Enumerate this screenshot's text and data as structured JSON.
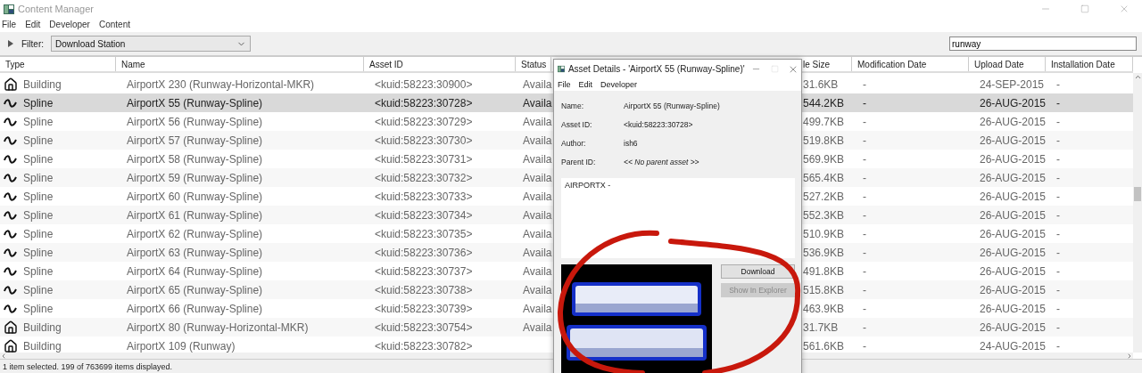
{
  "window": {
    "title": "Content Manager"
  },
  "menu": [
    "File",
    "Edit",
    "Developer",
    "Content"
  ],
  "filter": {
    "label": "Filter:",
    "value": "Download Station"
  },
  "search": {
    "value": "runway"
  },
  "table": {
    "columns": [
      "Type",
      "Name",
      "Asset ID",
      "Status",
      "le Size",
      "Modification Date",
      "Upload Date",
      "Installation Date"
    ],
    "rows": [
      {
        "kind": "building",
        "type": "Building",
        "name": "AirportX 230 (Runway-Horizontal-MKR)",
        "asset_id": "<kuid:58223:30900>",
        "status": "Availa",
        "file_size": "31.6KB",
        "modification_date": "-",
        "upload_date": "24-SEP-2015",
        "installation_date": "-",
        "selected": false
      },
      {
        "kind": "spline",
        "type": "Spline",
        "name": "AirportX 55 (Runway-Spline)",
        "asset_id": "<kuid:58223:30728>",
        "status": "Availa",
        "file_size": "544.2KB",
        "modification_date": "-",
        "upload_date": "26-AUG-2015",
        "installation_date": "-",
        "selected": true
      },
      {
        "kind": "spline",
        "type": "Spline",
        "name": "AirportX 56 (Runway-Spline)",
        "asset_id": "<kuid:58223:30729>",
        "status": "Availa",
        "file_size": "499.7KB",
        "modification_date": "-",
        "upload_date": "26-AUG-2015",
        "installation_date": "-",
        "selected": false
      },
      {
        "kind": "spline",
        "type": "Spline",
        "name": "AirportX 57 (Runway-Spline)",
        "asset_id": "<kuid:58223:30730>",
        "status": "Availa",
        "file_size": "519.8KB",
        "modification_date": "-",
        "upload_date": "26-AUG-2015",
        "installation_date": "-",
        "selected": false
      },
      {
        "kind": "spline",
        "type": "Spline",
        "name": "AirportX 58 (Runway-Spline)",
        "asset_id": "<kuid:58223:30731>",
        "status": "Availa",
        "file_size": "569.9KB",
        "modification_date": "-",
        "upload_date": "26-AUG-2015",
        "installation_date": "-",
        "selected": false
      },
      {
        "kind": "spline",
        "type": "Spline",
        "name": "AirportX 59 (Runway-Spline)",
        "asset_id": "<kuid:58223:30732>",
        "status": "Availa",
        "file_size": "565.4KB",
        "modification_date": "-",
        "upload_date": "26-AUG-2015",
        "installation_date": "-",
        "selected": false
      },
      {
        "kind": "spline",
        "type": "Spline",
        "name": "AirportX 60 (Runway-Spline)",
        "asset_id": "<kuid:58223:30733>",
        "status": "Availa",
        "file_size": "527.2KB",
        "modification_date": "-",
        "upload_date": "26-AUG-2015",
        "installation_date": "-",
        "selected": false
      },
      {
        "kind": "spline",
        "type": "Spline",
        "name": "AirportX 61 (Runway-Spline)",
        "asset_id": "<kuid:58223:30734>",
        "status": "Availa",
        "file_size": "552.3KB",
        "modification_date": "-",
        "upload_date": "26-AUG-2015",
        "installation_date": "-",
        "selected": false
      },
      {
        "kind": "spline",
        "type": "Spline",
        "name": "AirportX 62 (Runway-Spline)",
        "asset_id": "<kuid:58223:30735>",
        "status": "Availa",
        "file_size": "510.9KB",
        "modification_date": "-",
        "upload_date": "26-AUG-2015",
        "installation_date": "-",
        "selected": false
      },
      {
        "kind": "spline",
        "type": "Spline",
        "name": "AirportX 63 (Runway-Spline)",
        "asset_id": "<kuid:58223:30736>",
        "status": "Availa",
        "file_size": "536.9KB",
        "modification_date": "-",
        "upload_date": "26-AUG-2015",
        "installation_date": "-",
        "selected": false
      },
      {
        "kind": "spline",
        "type": "Spline",
        "name": "AirportX 64 (Runway-Spline)",
        "asset_id": "<kuid:58223:30737>",
        "status": "Availa",
        "file_size": "491.8KB",
        "modification_date": "-",
        "upload_date": "26-AUG-2015",
        "installation_date": "-",
        "selected": false
      },
      {
        "kind": "spline",
        "type": "Spline",
        "name": "AirportX 65 (Runway-Spline)",
        "asset_id": "<kuid:58223:30738>",
        "status": "Availa",
        "file_size": "515.8KB",
        "modification_date": "-",
        "upload_date": "26-AUG-2015",
        "installation_date": "-",
        "selected": false
      },
      {
        "kind": "spline",
        "type": "Spline",
        "name": "AirportX 66 (Runway-Spline)",
        "asset_id": "<kuid:58223:30739>",
        "status": "Availa",
        "file_size": "463.9KB",
        "modification_date": "-",
        "upload_date": "26-AUG-2015",
        "installation_date": "-",
        "selected": false
      },
      {
        "kind": "building",
        "type": "Building",
        "name": "AirportX 80 (Runway-Horizontal-MKR)",
        "asset_id": "<kuid:58223:30754>",
        "status": "Availa",
        "file_size": "31.7KB",
        "modification_date": "-",
        "upload_date": "26-AUG-2015",
        "installation_date": "-",
        "selected": false
      },
      {
        "kind": "building",
        "type": "Building",
        "name": "AirportX 109 (Runway)",
        "asset_id": "<kuid:58223:30782>",
        "file_size": "561.6KB",
        "modification_date": "-",
        "upload_date": "24-AUG-2015",
        "installation_date": "-",
        "selected": false
      }
    ]
  },
  "status_bar": "1 item selected. 199 of 763699 items displayed.",
  "dialog": {
    "title": "Asset Details - 'AirportX 55 (Runway-Spline)'",
    "menu": [
      "File",
      "Edit",
      "Developer"
    ],
    "fields": [
      {
        "label": "Name:",
        "value": "AirportX 55 (Runway-Spline)",
        "italic": false
      },
      {
        "label": "Asset ID:",
        "value": "<kuid:58223:30728>",
        "italic": false
      },
      {
        "label": "Author:",
        "value": "ish6",
        "italic": false
      },
      {
        "label": "Parent ID:",
        "value": "<< No parent asset >>",
        "italic": true
      }
    ],
    "description": "AIRPORTX -",
    "thumbnail": {
      "kind": "picture"
    },
    "buttons": [
      {
        "label": "Download",
        "disabled": false
      },
      {
        "label": "Show In Explorer",
        "disabled": true
      }
    ]
  }
}
